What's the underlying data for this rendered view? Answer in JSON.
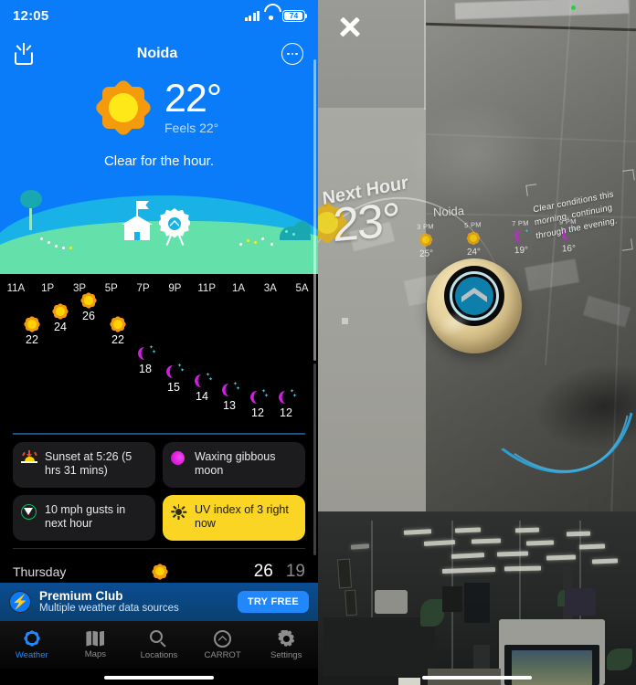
{
  "left_panel": {
    "status_bar": {
      "time": "12:05",
      "battery_level": "74",
      "signal_icon": "cellular-bars-icon",
      "wifi_icon": "wifi-icon",
      "battery_icon": "battery-icon"
    },
    "nav": {
      "city": "Noida",
      "share_icon": "share-icon",
      "more_icon": "more-options-icon"
    },
    "current": {
      "condition_icon": "sun-icon",
      "temperature": "22°",
      "feels_like": "Feels 22°",
      "summary": "Clear for the hour."
    },
    "hourly": {
      "labels": [
        "11A",
        "1P",
        "3P",
        "5P",
        "7P",
        "9P",
        "11P",
        "1A",
        "3A",
        "5A"
      ],
      "points": [
        {
          "hour": "11A",
          "temp": "22",
          "icon": "sun-icon"
        },
        {
          "hour": "1P",
          "temp": "24",
          "icon": "sun-icon"
        },
        {
          "hour": "3P",
          "temp": "26",
          "icon": "sun-icon"
        },
        {
          "hour": "5P",
          "temp": "22",
          "icon": "sun-icon"
        },
        {
          "hour": "7P",
          "temp": "18",
          "icon": "moon-icon"
        },
        {
          "hour": "9P",
          "temp": "15",
          "icon": "moon-icon"
        },
        {
          "hour": "11P",
          "temp": "14",
          "icon": "moon-icon"
        },
        {
          "hour": "1A",
          "temp": "13",
          "icon": "moon-icon"
        },
        {
          "hour": "3A",
          "temp": "12",
          "icon": "moon-icon"
        },
        {
          "hour": "5A",
          "temp": "12",
          "icon": "moon-icon"
        }
      ]
    },
    "info_cards": [
      {
        "icon": "sunset-icon",
        "text": "Sunset at 5:26 (5 hrs 31 mins)",
        "highlight": false
      },
      {
        "icon": "moon-phase-icon",
        "text": "Waxing gibbous moon",
        "highlight": false
      },
      {
        "icon": "wind-icon",
        "text": "10 mph gusts in next hour",
        "highlight": false
      },
      {
        "icon": "uv-sun-icon",
        "text": "UV index of 3 right now",
        "highlight": true
      }
    ],
    "daily_row": {
      "day": "Thursday",
      "icon": "sun-icon",
      "high": "26",
      "low": "19"
    },
    "promo": {
      "icon": "lightning-bolt-icon",
      "title": "Premium Club",
      "subtitle": "Multiple weather data sources",
      "button": "TRY FREE"
    },
    "tabs": [
      {
        "label": "Weather",
        "icon": "sun-outline-icon",
        "active": true
      },
      {
        "label": "Maps",
        "icon": "map-icon",
        "active": false
      },
      {
        "label": "Locations",
        "icon": "search-icon",
        "active": false
      },
      {
        "label": "CARROT",
        "icon": "carrot-robot-icon",
        "active": false
      },
      {
        "label": "Settings",
        "icon": "gear-icon",
        "active": false
      }
    ]
  },
  "right_panel": {
    "close_icon": "close-x-icon",
    "recording_indicator": "green-privacy-dot",
    "ar": {
      "heading": "Next Hour",
      "temperature": "23°",
      "city": "Noida",
      "sun_icon": "sun-icon",
      "hours": [
        {
          "label": "3 PM",
          "temp": "25°",
          "icon": "sun-icon"
        },
        {
          "label": "5 PM",
          "temp": "24°",
          "icon": "sun-icon"
        },
        {
          "label": "7 PM",
          "temp": "19°",
          "icon": "moon-icon"
        },
        {
          "label": "9 PM",
          "temp": "16°",
          "icon": "moon-icon"
        }
      ],
      "note_lines": [
        "Clear conditions this",
        "morning, continuing",
        "through the evening."
      ]
    },
    "robot": {
      "name": "carrot-robot",
      "eye_icon": "chevron-up-icon"
    }
  },
  "colors": {
    "sky_blue": "#0a7cfa",
    "accent_blue": "#2287fb",
    "card_dark": "#1c1c1e",
    "highlight_yellow": "#fbd524",
    "moon_magenta": "#d11fe0",
    "sun_orange": "#f59a0c",
    "wind_green": "#12b866"
  }
}
